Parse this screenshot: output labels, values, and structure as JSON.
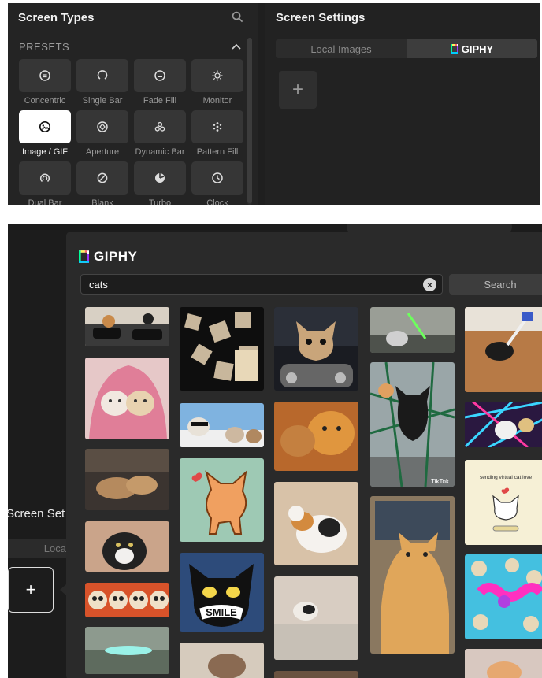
{
  "screen_types": {
    "title": "Screen Types",
    "presets_label": "PRESETS",
    "tiles": [
      {
        "label": "Concentric",
        "icon": "concentric-icon"
      },
      {
        "label": "Single Bar",
        "icon": "single-bar-icon"
      },
      {
        "label": "Fade Fill",
        "icon": "fade-fill-icon"
      },
      {
        "label": "Monitor",
        "icon": "monitor-icon"
      },
      {
        "label": "Image / GIF",
        "icon": "image-gif-icon",
        "selected": true
      },
      {
        "label": "Aperture",
        "icon": "aperture-icon"
      },
      {
        "label": "Dynamic Bar",
        "icon": "dynamic-bar-icon"
      },
      {
        "label": "Pattern Fill",
        "icon": "pattern-fill-icon"
      },
      {
        "label": "Dual Bar",
        "icon": "dual-bar-icon"
      },
      {
        "label": "Blank",
        "icon": "blank-icon"
      },
      {
        "label": "Turbo",
        "icon": "turbo-icon"
      },
      {
        "label": "Clock",
        "icon": "clock-icon"
      }
    ]
  },
  "screen_settings": {
    "title": "Screen Settings",
    "tab_local": "Local Images",
    "tab_giphy": "GIPHY",
    "add_label": "+"
  },
  "background": {
    "title": "Screen Set",
    "local_label": "Loca",
    "add_label": "+"
  },
  "giphy": {
    "brand": "GIPHY",
    "search_value": "cats",
    "clear_label": "×",
    "search_button": "Search",
    "gif_caption": "sending virtual cat love",
    "gif_word": "SMILE",
    "tiktok_label": "TikTok"
  },
  "colors": {
    "panel_bg": "#242424",
    "tile_bg": "#363636",
    "tile_active": "#ffffff",
    "popup_bg": "#2a2a2a",
    "giphy_green": "#00ff99",
    "giphy_blue": "#00ccff",
    "giphy_purple": "#9933ff",
    "giphy_pink": "#ff6666",
    "giphy_yellow": "#fff35c"
  }
}
